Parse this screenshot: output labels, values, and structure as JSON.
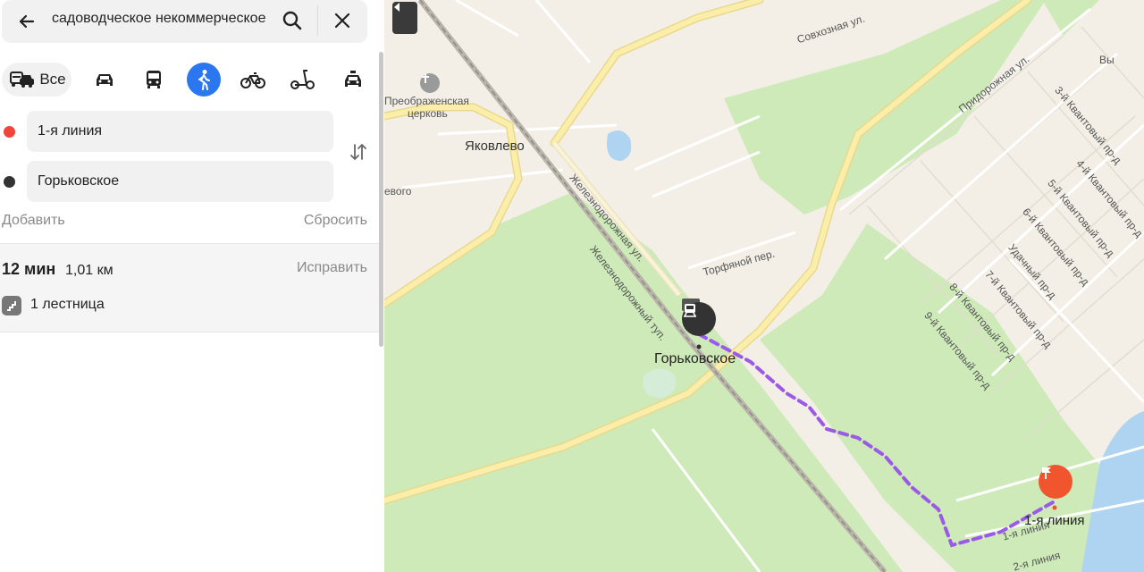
{
  "search": {
    "query": "садоводческое некоммерческое",
    "back_icon": "arrow-left-icon",
    "search_icon": "magnifier-icon",
    "close_icon": "close-icon"
  },
  "transport_modes": {
    "all_label": "Все",
    "active": "pedestrian",
    "items": [
      "all",
      "car",
      "bus",
      "pedestrian",
      "bicycle",
      "scooter",
      "taxi"
    ]
  },
  "waypoints": [
    {
      "value": "1-я линия",
      "dot_color": "#f0453a"
    },
    {
      "value": "Горьковское",
      "dot_color": "#333333"
    }
  ],
  "actions": {
    "add": "Добавить",
    "reset": "Сбросить"
  },
  "route": {
    "time": "12 мин",
    "distance": "1,01 км",
    "fix": "Исправить",
    "stairs": "1 лестница"
  },
  "map": {
    "labels": {
      "church": "Преображенская\nцерковь",
      "church_line1": "Преображенская",
      "church_line2": "церковь",
      "village": "Яковлево",
      "sovkhoznaya": "Совхозная ул.",
      "railway_street": "Железнодорожная ул.",
      "railway_lane": "Железнодорожный туп.",
      "torfyanoy": "Торфяной пер.",
      "station": "Горьковское",
      "finish": "1-я линия",
      "left_cut": "евого",
      "pridorozhnaya": "Придорожная ул.",
      "kv3": "3-й Квантовый пр-д",
      "kv4": "4-й Квантовый пр-д",
      "kv5": "5-й Квантовый пр-д",
      "kv6": "6-й Квантовый пр-д",
      "udachny": "Удачный пр-д",
      "kv7": "7-й Квантовый пр-д",
      "kv8": "8-й Квантовый пр-д",
      "kv9": "9-й Квантовый пр-д",
      "line1_small": "1-я линия",
      "line2_small": "2-я линия",
      "top_right_cut": "Вы"
    },
    "colors": {
      "route": "#9b59e8",
      "forest": "#cdeab8",
      "water": "#aed4f2",
      "road": "#f7e08b",
      "land": "#f3efe6"
    }
  }
}
